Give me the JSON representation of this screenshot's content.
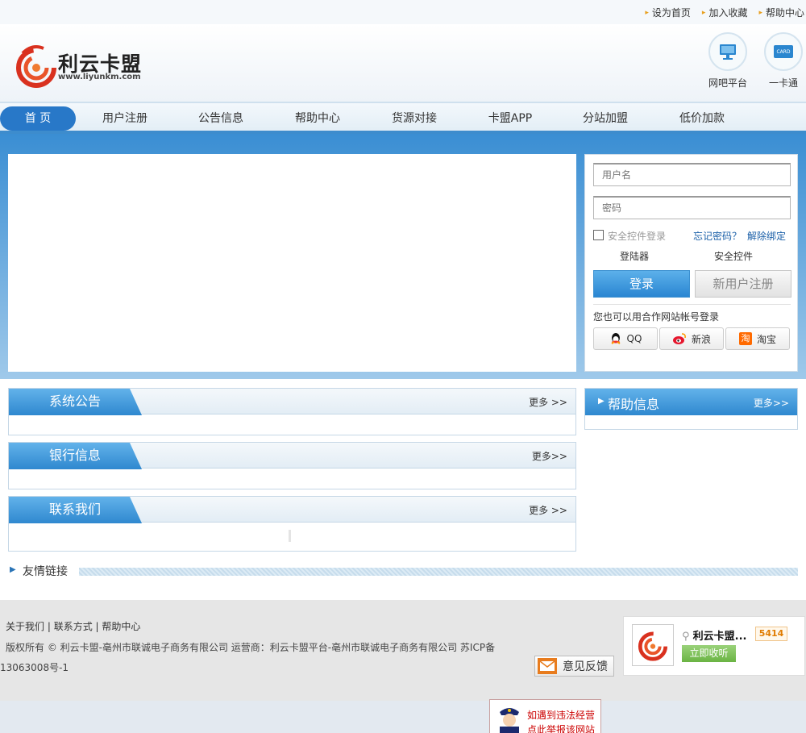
{
  "toplinks": [
    "设为首页",
    "加入收藏",
    "帮助中心"
  ],
  "logo": {
    "name": "利云卡盟",
    "url": "www.liyunkm.com"
  },
  "header_icons": [
    {
      "icon": "monitor-icon",
      "label": "网吧平台"
    },
    {
      "icon": "card-icon",
      "label": "一卡通",
      "card_text": "CARD"
    }
  ],
  "nav": [
    "首 页",
    "用户注册",
    "公告信息",
    "帮助中心",
    "货源对接",
    "卡盟APP",
    "分站加盟",
    "低价加款"
  ],
  "login": {
    "username_placeholder": "用户名",
    "password_placeholder": "密码",
    "secure_login": "安全控件登录",
    "forgot": "忘记密码？",
    "unbind": "解除绑定",
    "login_tool": "登陆器",
    "secure_ctrl": "安全控件",
    "login_btn": "登录",
    "register_btn": "新用户注册",
    "partner_text": "您也可以用合作网站帐号登录",
    "partners": [
      {
        "icon": "qq-icon",
        "label": "QQ"
      },
      {
        "icon": "weibo-icon",
        "label": "新浪"
      },
      {
        "icon": "taobao-icon",
        "label": "淘宝",
        "glyph": "淘"
      }
    ]
  },
  "sections": [
    {
      "title": "系统公告",
      "more": "更多 >>"
    },
    {
      "title": "银行信息",
      "more": "更多>>"
    },
    {
      "title": "联系我们",
      "more": "更多 >>"
    }
  ],
  "help": {
    "title": "帮助信息",
    "more": "更多>>"
  },
  "friends": {
    "title": "友情链接"
  },
  "footer": {
    "links": [
      "关于我们",
      "联系方式",
      "帮助中心"
    ],
    "copyright": "版权所有 ©  利云卡盟-亳州市联诚电子商务有限公司    运营商：利云卡盟平台-亳州市联诚电子商务有限公司   苏ICP备",
    "icp": "13063008号-1",
    "feedback": "意见反馈",
    "radio": {
      "name": "利云卡盟...",
      "count": "5414",
      "listen_btn": "立即收听"
    },
    "police": "如遇到违法经营点此举报该网站"
  },
  "colors": {
    "accent": "#2878c8",
    "nav_active": "#2878c8",
    "banner": "#3a8ed3"
  }
}
